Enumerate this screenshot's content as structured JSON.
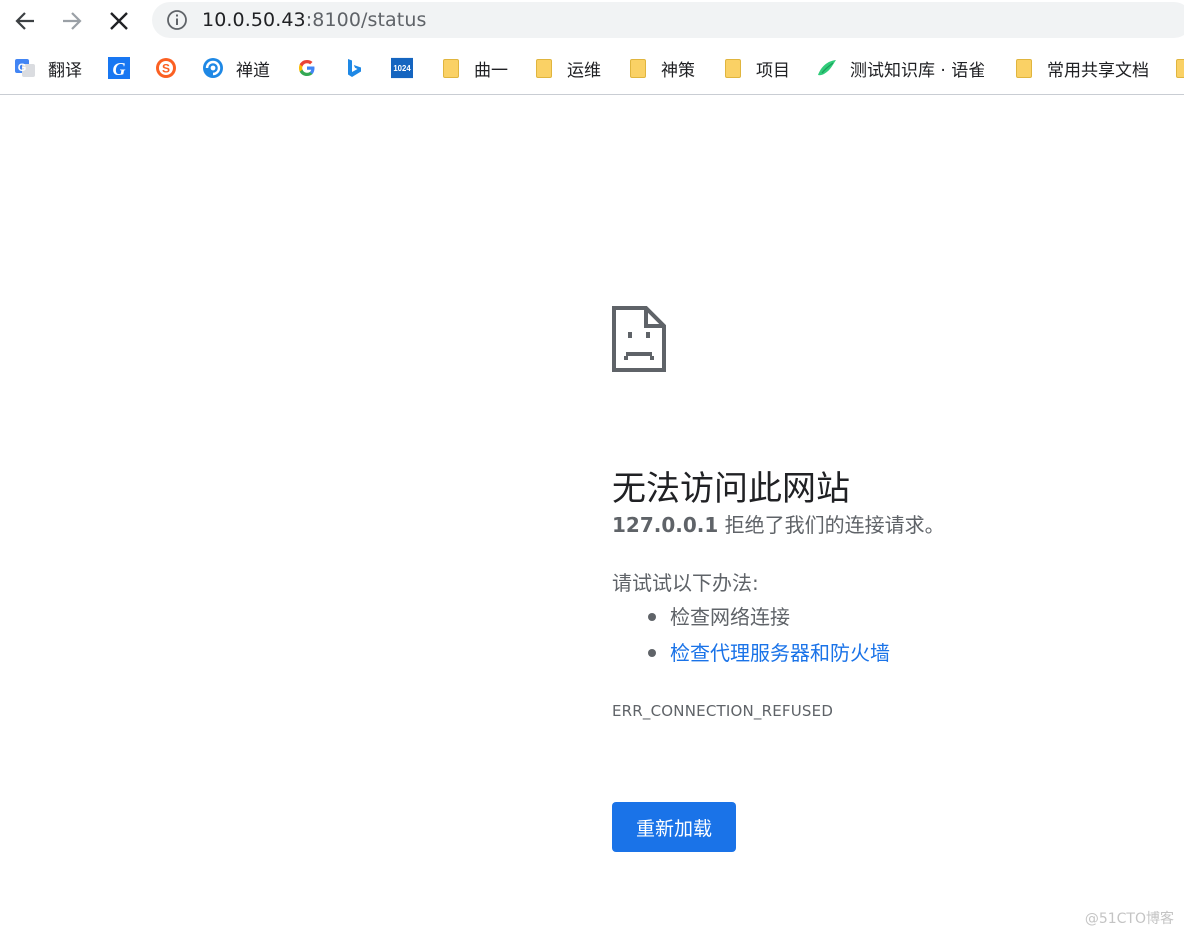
{
  "browser": {
    "address": {
      "host": "10.0.50.43",
      "rest": ":8100/status"
    },
    "bookmarks": [
      {
        "label": "翻译",
        "icon": "translate-icon"
      },
      {
        "label": "",
        "icon": "g-logo-icon"
      },
      {
        "label": "",
        "icon": "sogou-icon"
      },
      {
        "label": "禅道",
        "icon": "zentao-icon"
      },
      {
        "label": "",
        "icon": "google-icon"
      },
      {
        "label": "",
        "icon": "bing-icon"
      },
      {
        "label": "",
        "icon": "site-1024-icon",
        "icon_text": "1024"
      },
      {
        "label": "曲一",
        "icon": "folder-icon"
      },
      {
        "label": "运维",
        "icon": "folder-icon"
      },
      {
        "label": "神策",
        "icon": "folder-icon"
      },
      {
        "label": "项目",
        "icon": "folder-icon"
      },
      {
        "label": "测试知识库 · 语雀",
        "icon": "yuque-icon"
      },
      {
        "label": "常用共享文档",
        "icon": "folder-icon"
      }
    ]
  },
  "error_page": {
    "title": "无法访问此网站",
    "host": "127.0.0.1",
    "message": " 拒绝了我们的连接请求。",
    "hint": "请试试以下办法:",
    "suggestions": [
      "检查网络连接",
      "检查代理服务器和防火墙"
    ],
    "error_code": "ERR_CONNECTION_REFUSED",
    "reload_label": "重新加载"
  },
  "watermark": "@51CTO博客",
  "colors": {
    "accent": "#1a73e8",
    "text_secondary": "#5f6368",
    "folder": "#fad165"
  }
}
